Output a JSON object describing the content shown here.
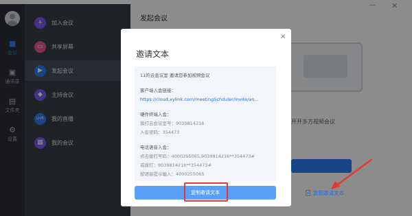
{
  "rail": {
    "items": [
      {
        "label": "会议",
        "icon": "video-camera-icon",
        "active": true
      },
      {
        "label": "通讯录",
        "icon": "contacts-icon",
        "active": false
      },
      {
        "label": "文件夹",
        "icon": "folder-icon",
        "active": false
      },
      {
        "label": "设置",
        "icon": "gear-icon",
        "active": false
      }
    ]
  },
  "menu": {
    "items": [
      {
        "label": "加入会议",
        "icon": "plus-circle-icon",
        "color": "#7a5cf0"
      },
      {
        "label": "共享屏幕",
        "icon": "share-screen-icon",
        "color": "#e65c8a"
      },
      {
        "label": "发起会议",
        "icon": "video-start-icon",
        "color": "#2f7cf6"
      },
      {
        "label": "主持会议",
        "icon": "host-icon",
        "color": "#7a5cf0"
      },
      {
        "label": "我的直播",
        "icon": "live-icon",
        "color": "#2f7cf6"
      },
      {
        "label": "我的会议",
        "icon": "calendar-icon",
        "color": "#7a5cf0"
      }
    ]
  },
  "main": {
    "title": "发起会议",
    "hint": "开开多方视频会议",
    "copy_link_label": "复制邀请文本"
  },
  "modal": {
    "title": "邀请文本",
    "close": "×",
    "lines": {
      "l1": "11的云会议室 邀请您参加视频会议",
      "l2": "客户端入会链接：",
      "l3": "https://cloud.xylink.com/meetingSchduler/invite/an...",
      "l4": "硬件终端入会：",
      "l5": "拨打云会议室号：9039814216",
      "l6": "入会密码：354473",
      "l7": "电话语音入会：",
      "l8": "点击拨打号码：4000255065,9039814216**354473#",
      "l9": "或拨打：9039814216**354473#",
      "l10": "按语音提示输入：4000255065"
    },
    "copy_button": "复制邀请文本"
  },
  "colors": {
    "accent": "#2f7cf6",
    "annotation": "#e53935"
  }
}
